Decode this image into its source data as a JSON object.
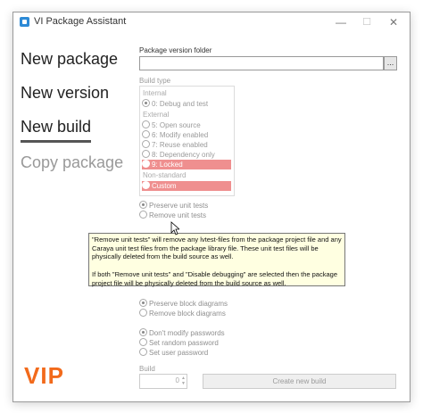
{
  "window": {
    "title": "VI Package Assistant",
    "controls": {
      "minimize": "—",
      "maximize": "☐",
      "close": "✕"
    }
  },
  "nav": {
    "new_package": "New package",
    "new_version": "New version",
    "new_build": "New build",
    "copy_package": "Copy package"
  },
  "form": {
    "package_folder_label": "Package version folder",
    "package_folder_value": "",
    "browse_label": "...",
    "build_type_label": "Build type",
    "groups": {
      "internal": "Internal",
      "external": "External",
      "non_standard": "Non-standard"
    },
    "build_options": [
      {
        "label": "0: Debug and test",
        "selected": true
      },
      {
        "label": "5: Open source",
        "selected": false
      },
      {
        "label": "6: Modify enabled",
        "selected": false
      },
      {
        "label": "7: Reuse enabled",
        "selected": false
      },
      {
        "label": "8: Dependency only",
        "selected": false
      },
      {
        "label": "9: Locked",
        "selected": false
      },
      {
        "label": "Custom",
        "selected": false
      }
    ],
    "unit_tests": {
      "preserve": "Preserve unit tests",
      "remove": "Remove unit tests"
    },
    "block_diagrams": {
      "preserve": "Preserve block diagrams",
      "remove": "Remove block diagrams"
    },
    "passwords": {
      "dont_modify": "Don't modify passwords",
      "random": "Set random password",
      "user": "Set user password"
    },
    "build_label": "Build",
    "build_value": "0",
    "create_button": "Create new build"
  },
  "tooltip": {
    "p1": "\"Remove unit tests\" will remove any lvtest-files from the package project file and any Caraya unit test files from the package library file. These unit test files will be physically deleted from the build source as well.",
    "p2": "If both \"Remove unit tests\" and \"Disable debugging\" are selected then the package project file will be physically deleted from the build source as well."
  },
  "logo": {
    "text": "VIP"
  },
  "colors": {
    "locked_highlight": "#ef8f8f",
    "logo": "#f26a1b",
    "tooltip_bg": "#ffffe1"
  }
}
